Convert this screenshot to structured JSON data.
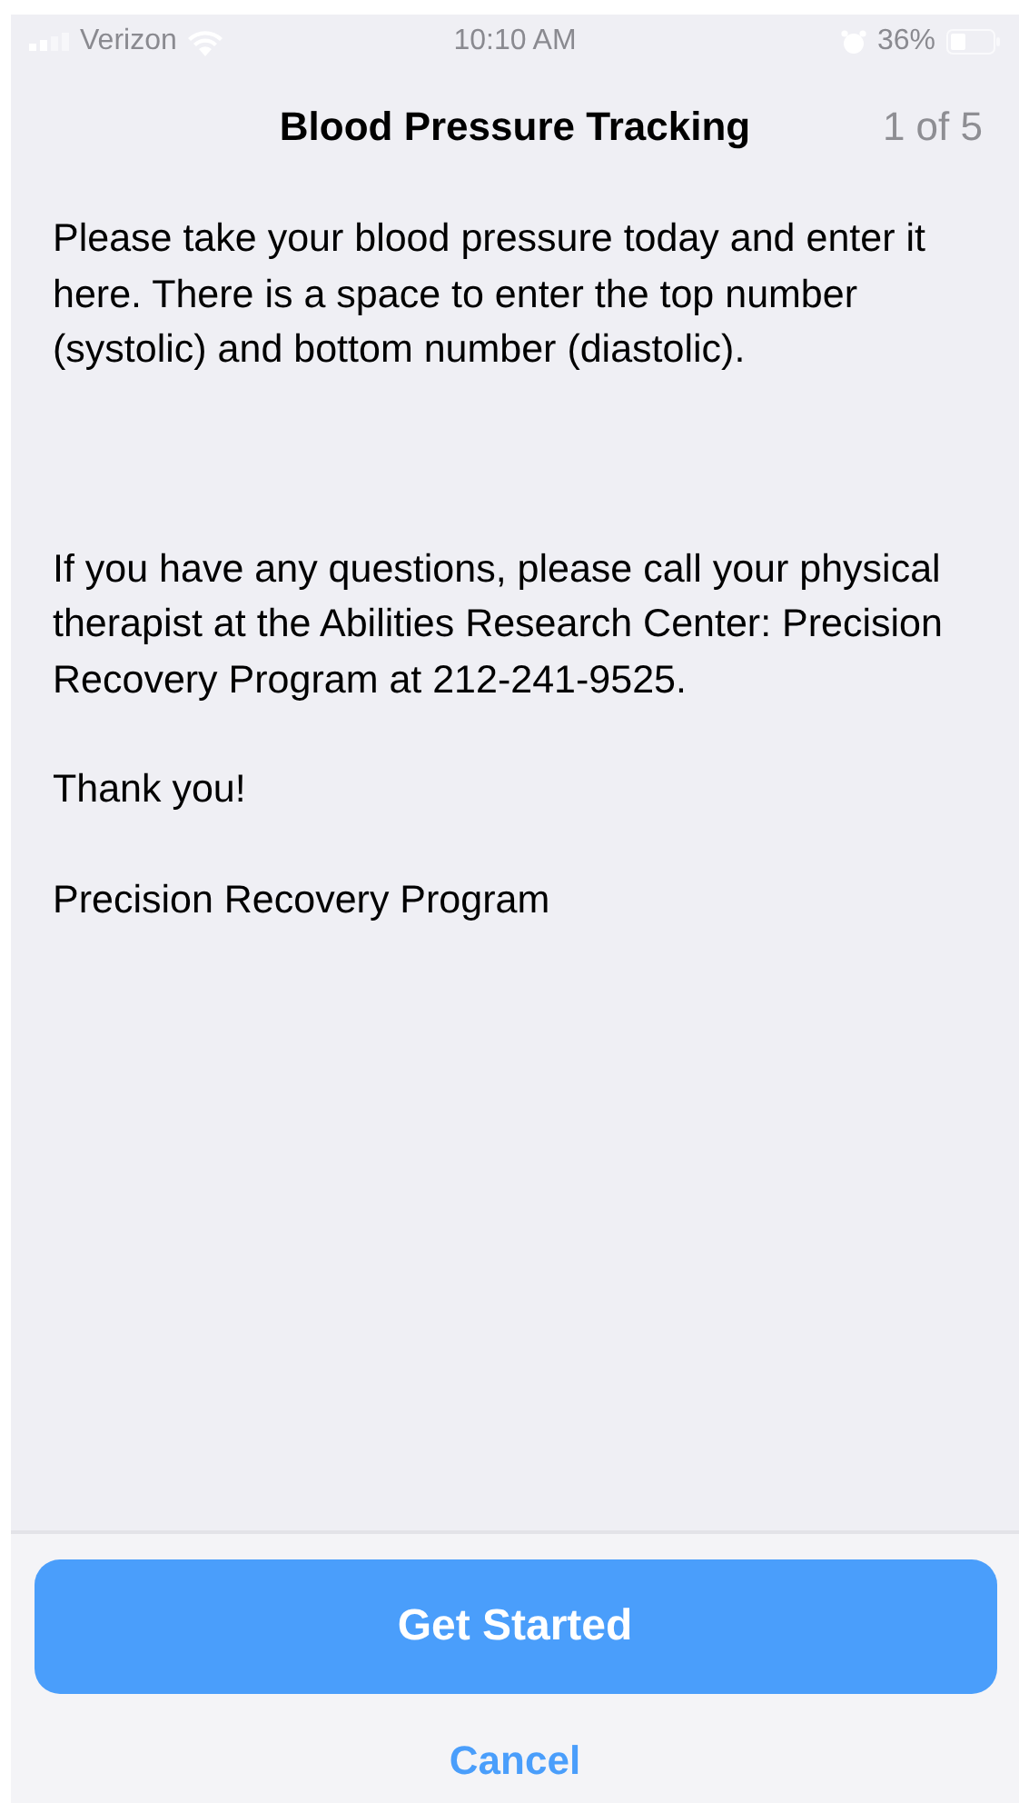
{
  "status_bar": {
    "carrier": "Verizon",
    "time": "10:10 AM",
    "battery": "36%"
  },
  "nav": {
    "title": "Blood Pressure Tracking",
    "step": "1 of 5"
  },
  "paragraphs": [
    "Please take your blood pressure today and enter it here. There is a space to enter the top number (systolic) and bottom number (diastolic).",
    "If you have any questions, please call your physical therapist at the Abilities Research Center: Precision Recovery Program at 212-241-9525.",
    "Thank you!",
    "Precision Recovery Program"
  ],
  "buttons": {
    "primary": "Get Started",
    "secondary": "Cancel"
  }
}
